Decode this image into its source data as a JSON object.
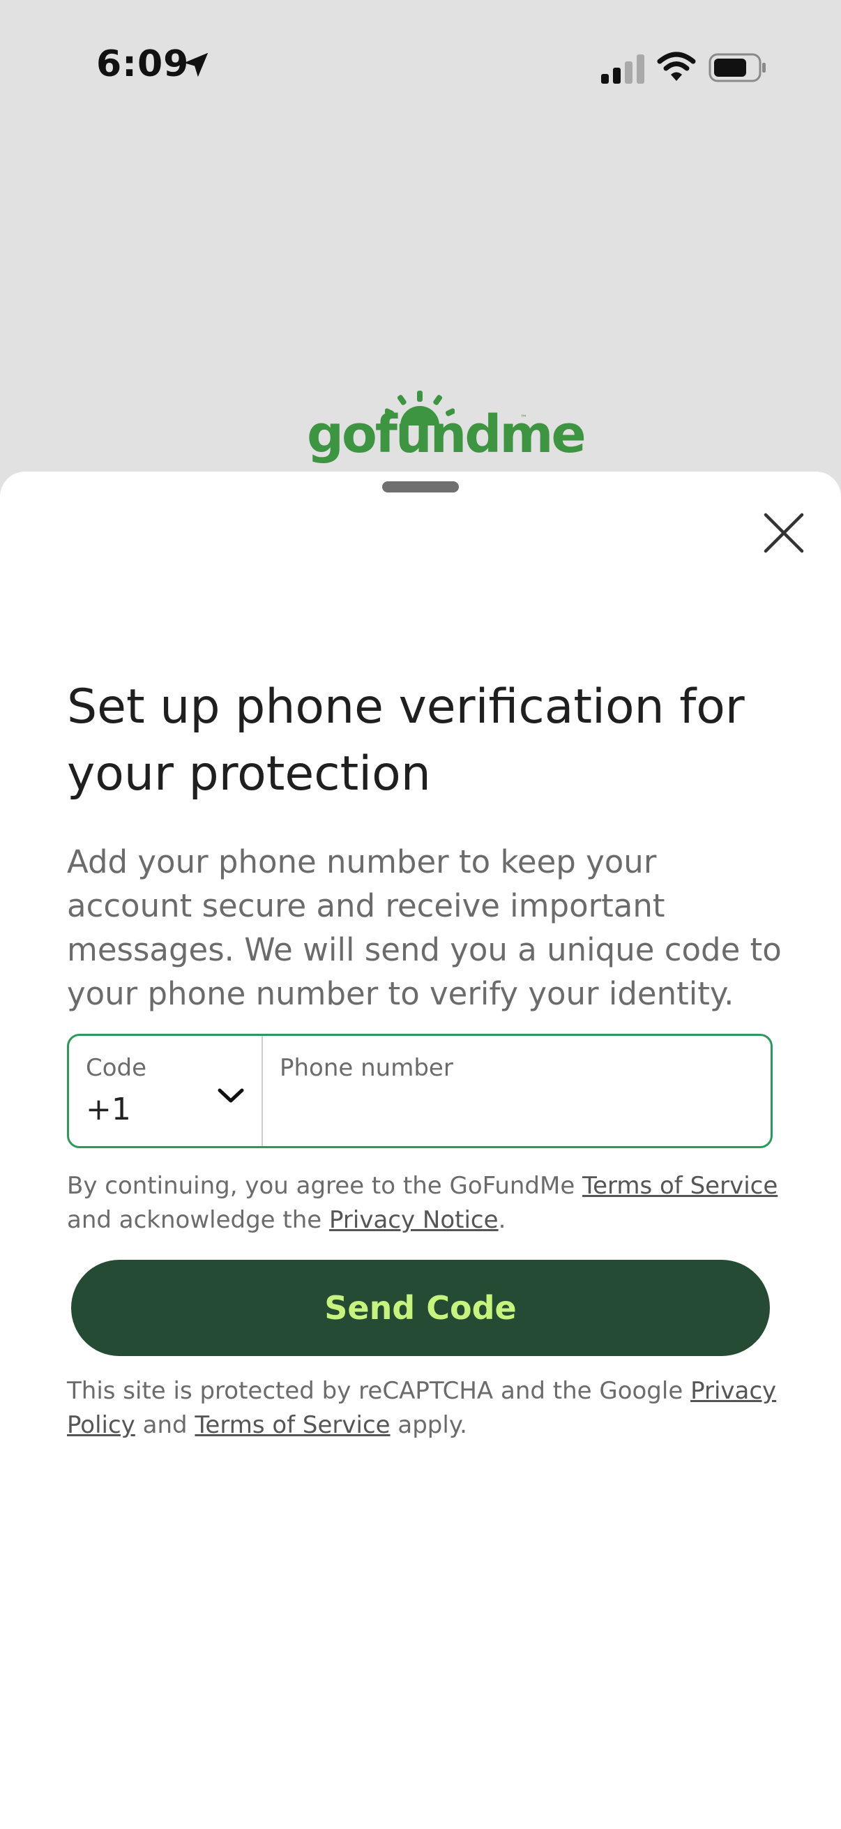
{
  "status_bar": {
    "time": "6:09"
  },
  "brand": {
    "logo_text": "gofundme",
    "trademark": "™",
    "color": "#3d9541"
  },
  "dialog": {
    "title": "Set up phone verification for your protection",
    "description": "Add your phone number to keep your account secure and receive important messages. We will send you a unique code to your phone number to verify your identity.",
    "close_icon": "close-icon"
  },
  "phone_form": {
    "code_label": "Code",
    "code_value": "+1",
    "phone_label": "Phone number",
    "phone_value": "",
    "focus_color": "#2a9a5a"
  },
  "legal": {
    "prefix": "By continuing, you agree to the GoFundMe ",
    "terms_link": "Terms of Service",
    "middle": " and acknowledge the ",
    "privacy_link": "Privacy Notice",
    "suffix": "."
  },
  "send_button": {
    "label": "Send Code",
    "background": "#264b34",
    "text_color": "#c6f47c"
  },
  "recaptcha": {
    "prefix": "This site is protected by reCAPTCHA and the Google ",
    "privacy_link": "Privacy Policy",
    "middle": " and ",
    "terms_link": "Terms of Service",
    "suffix": " apply."
  }
}
